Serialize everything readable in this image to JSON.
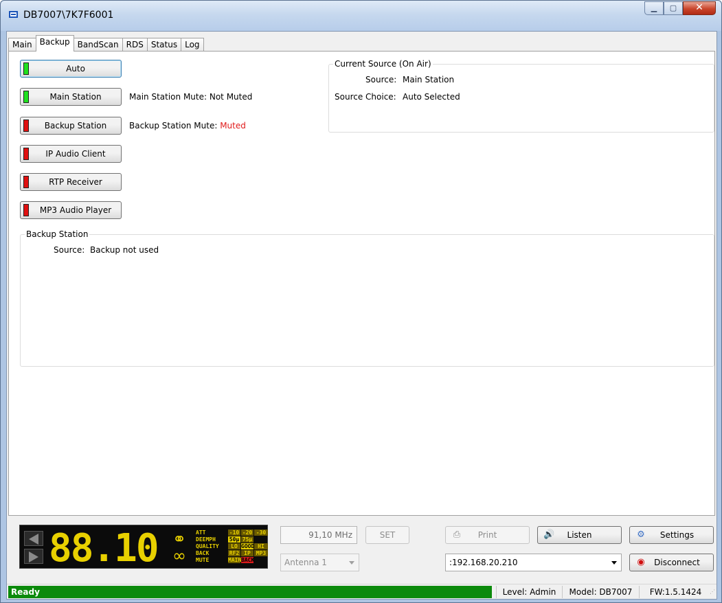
{
  "window": {
    "title": "DB7007\\7K7F6001",
    "icon": "app-window-icon"
  },
  "tabs": [
    "Main",
    "Backup",
    "BandScan",
    "RDS",
    "Status",
    "Log"
  ],
  "active_tab": "Backup",
  "sources": [
    {
      "label": "Auto",
      "led": "green"
    },
    {
      "label": "Main Station",
      "led": "green"
    },
    {
      "label": "Backup Station",
      "led": "red"
    },
    {
      "label": "IP Audio Client",
      "led": "red"
    },
    {
      "label": "RTP Receiver",
      "led": "red"
    },
    {
      "label": "MP3 Audio Player",
      "led": "red"
    }
  ],
  "mute": {
    "main_label": "Main Station Mute:",
    "main_value": "Not Muted",
    "backup_label": "Backup Station Mute:",
    "backup_value": "Muted"
  },
  "current_source": {
    "title": "Current Source (On Air)",
    "source_label": "Source:",
    "source_value": "Main Station",
    "choice_label": "Source Choice:",
    "choice_value": "Auto Selected"
  },
  "backup_station": {
    "title": "Backup Station",
    "source_label": "Source:",
    "source_value": "Backup not used"
  },
  "lcd": {
    "frequency": "88.10",
    "rows": [
      [
        "ATT",
        "-10",
        "-20",
        "-30"
      ],
      [
        "DEEMPH",
        "50μ",
        "75μ",
        ""
      ],
      [
        "QUALITY",
        "LO",
        "GOOD",
        "HI"
      ],
      [
        "BACK",
        "RF2",
        "IP",
        "MP3"
      ],
      [
        "MUTE",
        "MAIN",
        "BACK",
        ""
      ]
    ]
  },
  "frequency_field": "91,10 MHz",
  "set_label": "SET",
  "antenna": "Antenna 1",
  "print_label": "Print",
  "listen_label": "Listen",
  "settings_label": "Settings",
  "address": ":192.168.20.210",
  "disconnect_label": "Disconnect",
  "status": {
    "ready": "Ready",
    "level": "Level: Admin",
    "model": "Model: DB7007",
    "fw": "FW:1.5.1424"
  },
  "colors": {
    "status_green": "#0b8a0b",
    "led_green": "#1fe01f",
    "led_red": "#e01010",
    "muted_red": "#e01a1a",
    "lcd_yellow": "#e8d000"
  }
}
